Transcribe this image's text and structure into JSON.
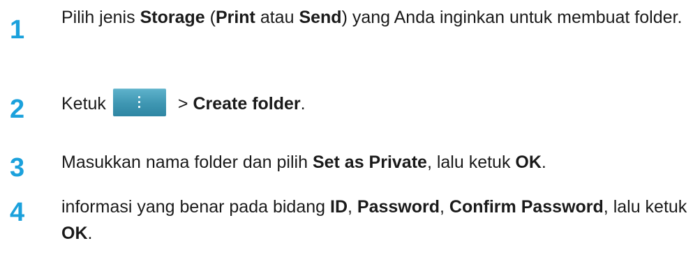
{
  "steps": [
    {
      "number": "1",
      "parts": [
        {
          "t": "Pilih jenis ",
          "b": false
        },
        {
          "t": "Storage",
          "b": true
        },
        {
          "t": " (",
          "b": false
        },
        {
          "t": "Print",
          "b": true
        },
        {
          "t": " atau ",
          "b": false
        },
        {
          "t": "Send",
          "b": true
        },
        {
          "t": ") yang Anda inginkan untuk membuat folder.",
          "b": false
        }
      ]
    },
    {
      "number": "2",
      "before": "Ketuk",
      "icon": "more-options-icon",
      "after_plain": " > ",
      "after_bold": "Create folder",
      "after_end": "."
    },
    {
      "number": "3",
      "parts": [
        {
          "t": "Masukkan nama folder dan pilih ",
          "b": false
        },
        {
          "t": "Set as Private",
          "b": true
        },
        {
          "t": ", lalu ketuk ",
          "b": false
        },
        {
          "t": "OK",
          "b": true
        },
        {
          "t": ".",
          "b": false
        }
      ]
    },
    {
      "number": "4",
      "parts": [
        {
          "t": "informasi yang benar pada bidang ",
          "b": false
        },
        {
          "t": "ID",
          "b": true
        },
        {
          "t": ", ",
          "b": false
        },
        {
          "t": "Password",
          "b": true
        },
        {
          "t": ", ",
          "b": false
        },
        {
          "t": "Confirm Password",
          "b": true
        },
        {
          "t": ", lalu ketuk ",
          "b": false
        },
        {
          "t": "OK",
          "b": true
        },
        {
          "t": ".",
          "b": false
        }
      ]
    }
  ],
  "colors": {
    "step_number": "#1ba1dc",
    "button_bg": "#3e96b2"
  }
}
